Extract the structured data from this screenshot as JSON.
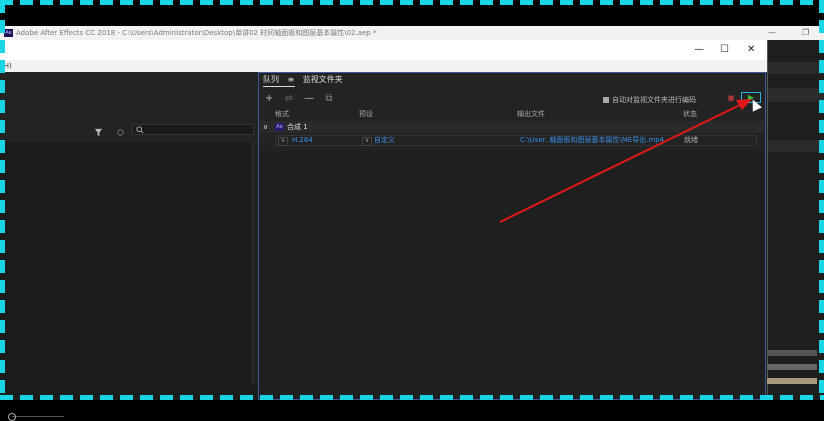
{
  "ae_window": {
    "title": "Adobe After Effects CC 2018 - C:\\Users\\Administrator\\Desktop\\单讲02  时间轴面板和图层基本属性\\02.aep *",
    "logo": "Ae",
    "controls": [
      "—",
      "❐"
    ]
  },
  "dialog": {
    "controls": [
      "—",
      "☐",
      "✕"
    ],
    "menu_fragment": "(H)"
  },
  "left_panel": {
    "filter_icon": "funnel-icon",
    "search_icon": "search-icon"
  },
  "render_queue": {
    "tabs": [
      {
        "label": "队列",
        "menu": "≡",
        "active": true
      },
      {
        "label": "监视文件夹",
        "active": false
      }
    ],
    "toolbar_icons": [
      "+",
      "⇌",
      "—",
      "⧉"
    ],
    "auto_encode_label": "自动对监视文件夹进行编码",
    "auto_encode_checked": true,
    "stop_glyph": "■",
    "render_glyph": "▶",
    "columns": [
      "格式",
      "预设",
      "输出文件",
      "状态"
    ],
    "group": {
      "chevron": "∨",
      "icon": "Ae",
      "name": "合成 1"
    },
    "item": {
      "format": "H.264",
      "preset": "自定义",
      "output_file": "C:\\User..轴面板和图层基本属性\\ME导出.mp4",
      "status": "就绪"
    }
  },
  "accent_colors": {
    "highlight_border": "#19d6e6",
    "arrow": "#e01818",
    "link_blue": "#3a8fe8",
    "render_green": "#3dc43d"
  }
}
